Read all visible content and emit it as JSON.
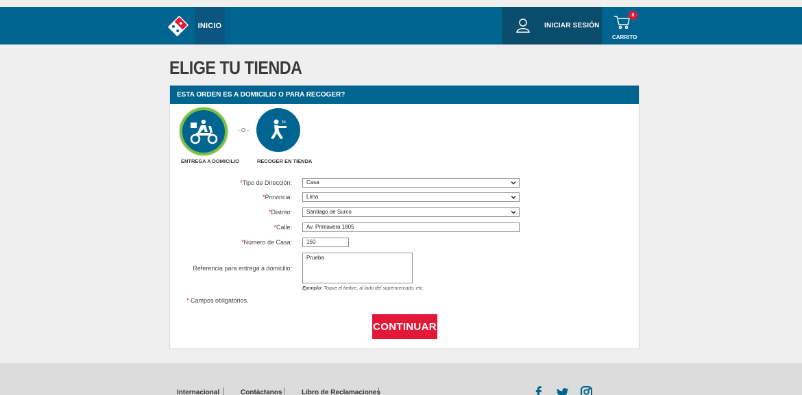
{
  "header": {
    "home_label": "INICIO",
    "login_label": "INICIAR SESIÓN",
    "cart_label": "CARRITO",
    "cart_count": "0",
    "brand_color": "#006491",
    "accent_color": "#e31837"
  },
  "page": {
    "title": "ELIGE TU TIENDA",
    "panel_heading": "ESTA ORDEN ES A DOMICILIO O PARA RECOGER?"
  },
  "order_type": {
    "delivery_label": "ENTREGA A DOMICILIO",
    "pickup_label": "RECOGER EN TIENDA",
    "separator": "- O -",
    "selected": "delivery"
  },
  "form": {
    "address_type": {
      "label": "Tipo de Dirección:",
      "value": "Casa"
    },
    "province": {
      "label": "Provincia:",
      "value": "Lima"
    },
    "district": {
      "label": "Distrito:",
      "value": "Santiago de Surco"
    },
    "street": {
      "label": "Calle:",
      "value": "Av. Primavera 1805"
    },
    "house_number": {
      "label": "Número de Casa:",
      "value": "150"
    },
    "reference": {
      "label": "Referencia para entrega a domicilio:",
      "value": "Prueba"
    },
    "hint_bold": "Ejemplo:",
    "hint_text": " Toque el timbre, al lado del supermercado, etc.",
    "required_mark": "*",
    "required_note": "Campos obligatorios."
  },
  "actions": {
    "continue_label": "CONTINUAR"
  },
  "footer": {
    "links": [
      "Internacional",
      "Contáctanos",
      "Libro de Reclamaciones"
    ],
    "social_icons": [
      "facebook-icon",
      "twitter-icon",
      "instagram-icon"
    ]
  }
}
